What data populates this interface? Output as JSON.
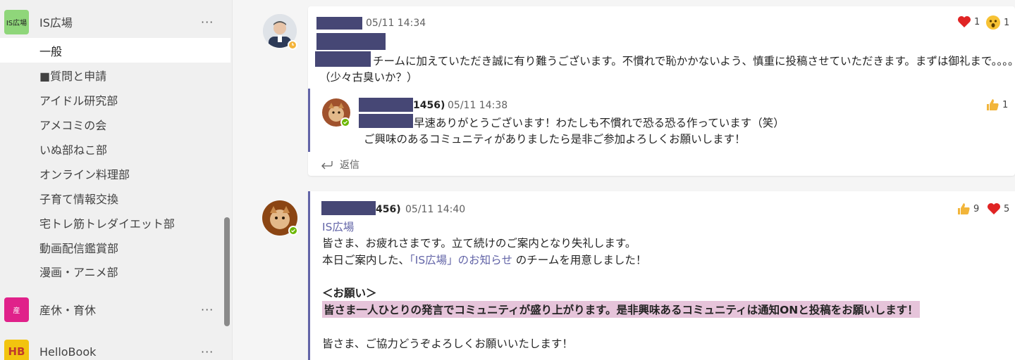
{
  "sidebar": {
    "teams": [
      {
        "avatar_text": "IS広場",
        "name": "IS広場",
        "more": "···",
        "avatar_color": "#8fd67a"
      },
      {
        "avatar_text": "産",
        "name": "産休・育休",
        "more": "···",
        "avatar_color": "#e0218a"
      },
      {
        "avatar_text": "HB",
        "name": "HelloBook",
        "more": "···",
        "avatar_color": "#f2c40f"
      }
    ],
    "channels": [
      "一般",
      "■質問と申請",
      "アイドル研究部",
      "アメコミの会",
      "いぬ部ねこ部",
      "オンライン料理部",
      "子育て情報交換",
      "宅トレ筋トレダイエット部",
      "動画配信鑑賞部",
      "漫画・アニメ部"
    ],
    "active_channel": "一般"
  },
  "messages": {
    "first": {
      "timestamp": "05/11 14:34",
      "line1": "チームに加えていただき誠に有り難うございます。不慣れで恥かかないよう、慎重に投稿させていただきます。まずは御礼まで。。。。",
      "line2": "（少々古臭いか？）",
      "reactions": [
        {
          "icon": "heart-icon",
          "count": "1"
        },
        {
          "icon": "surprised-icon",
          "count": "1"
        }
      ]
    },
    "reply": {
      "name_suffix": "1456)",
      "timestamp": "05/11 14:38",
      "line1": "早速ありがとうございます！わたしも不慣れで恐る恐る作っています（笑）",
      "line2": "ご興味のあるコミュニティがありましたら是非ご参加よろしくお願いします！",
      "reactions": [
        {
          "icon": "like-icon",
          "count": "1"
        }
      ],
      "reply_label": "返信"
    },
    "second": {
      "name_suffix": "456)",
      "timestamp": "05/11 14:40",
      "mention": "IS広場",
      "line1": "皆さま、お疲れさまです。立て続けのご案内となり失礼します。",
      "line2_prefix": "本日ご案内した、",
      "line2_link": "「IS広場」のお知らせ",
      "line2_suffix": " のチームを用意しました！",
      "heading": "＜お願い＞",
      "highlight": "皆さま一人ひとりの発言でコミュニティが盛り上がります。是非興味あるコミュニティは通知ONと投稿をお願いします！",
      "closing": "皆さま、ご協力どうぞよろしくお願いいたします！",
      "reactions": [
        {
          "icon": "like-icon",
          "count": "9"
        },
        {
          "icon": "heart-icon",
          "count": "5"
        }
      ]
    }
  },
  "colors": {
    "accent": "#6264a7",
    "redaction": "#464775",
    "highlight": "#e6c4da"
  }
}
